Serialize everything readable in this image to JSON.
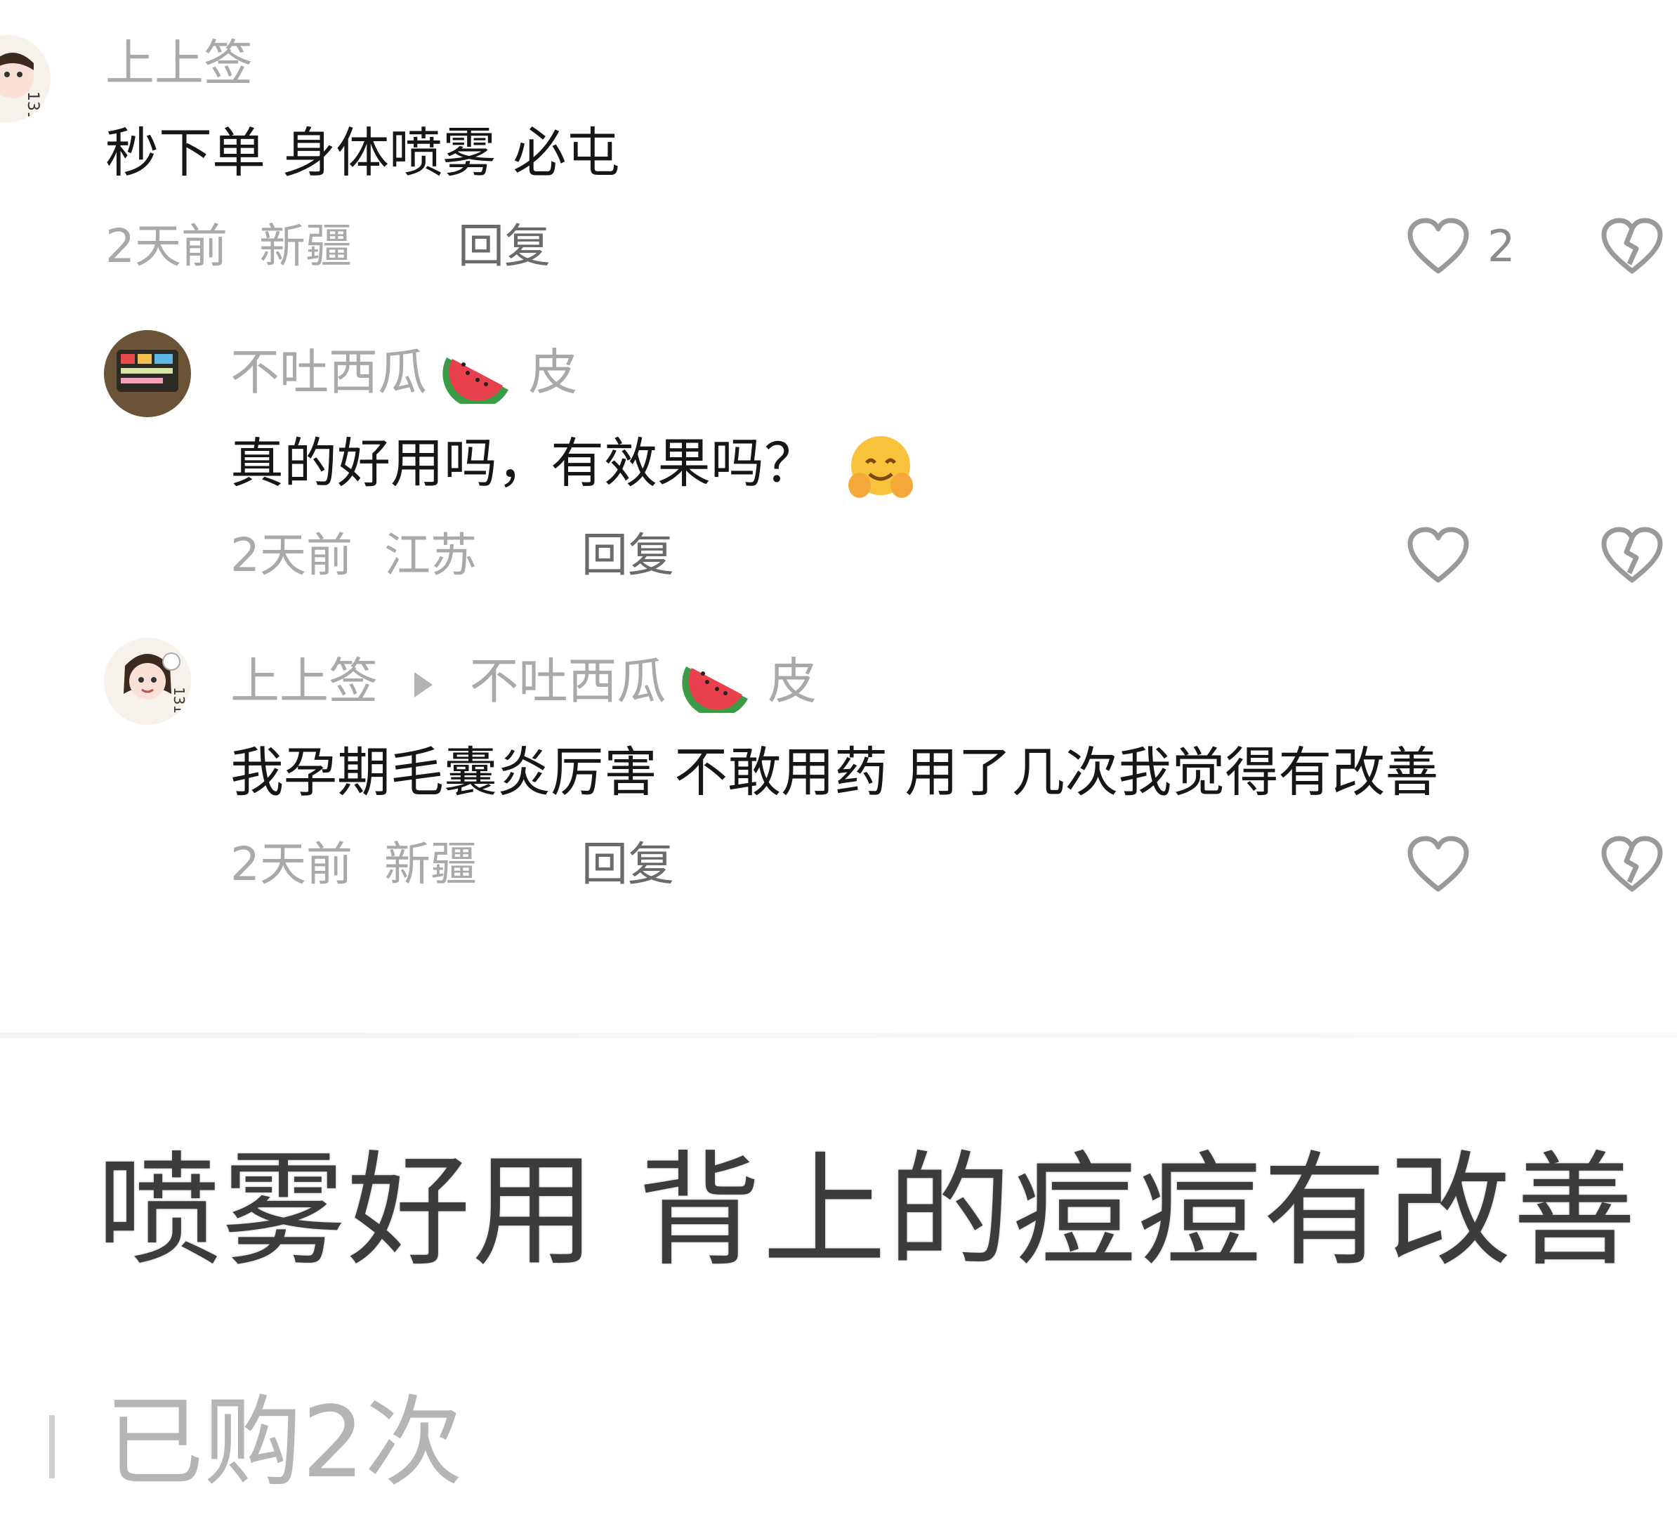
{
  "comments": [
    {
      "author": "上上签",
      "text": "秒下单 身体喷雾 必屯",
      "time": "2天前",
      "location": "新疆",
      "reply_label": "回复",
      "likes": "2"
    },
    {
      "author": "不吐西瓜",
      "author_suffix": "皮",
      "text": "真的好用吗，有效果吗？",
      "time": "2天前",
      "location": "江苏",
      "reply_label": "回复"
    },
    {
      "author": "上上签",
      "reply_to": "不吐西瓜",
      "reply_to_suffix": "皮",
      "text": "我孕期毛囊炎厉害 不敢用药 用了几次我觉得有改善",
      "time": "2天前",
      "location": "新疆",
      "reply_label": "回复"
    }
  ],
  "review": {
    "text": "喷雾好用 背上的痘痘有改善",
    "bought": "已购2次"
  },
  "colors": {
    "text_primary": "#161616",
    "text_secondary": "#a9a9a9",
    "watermelon_red": "#e8414d",
    "watermelon_green": "#3c9b46"
  }
}
